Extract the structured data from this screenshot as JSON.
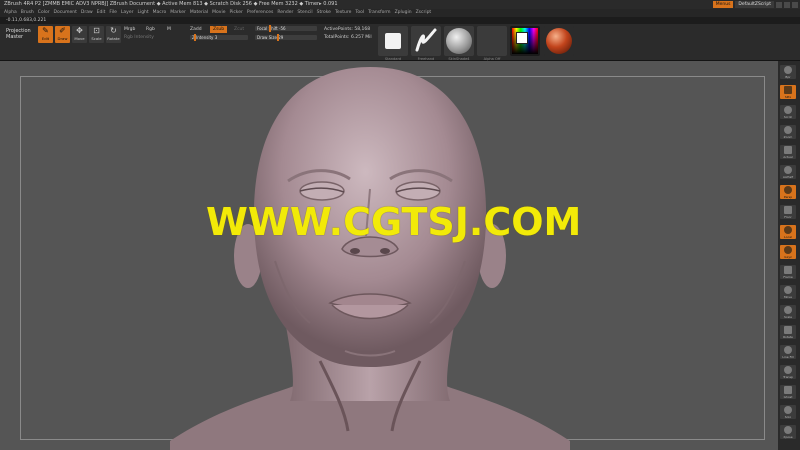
{
  "titlebar": {
    "text": "ZBrush 4R4 P2 [ZMMB EMIC ADV3 NPRBJ]   ZBrush Document      ◆ Active Mem 813  ◆ Scratch Disk 256  ◆ Free Mem 3232  ◆ Timer▸ 0.091",
    "menus_label": "Menus",
    "script_label": "DefaultZScript"
  },
  "menubar": {
    "items": [
      "Alpha",
      "Brush",
      "Color",
      "Document",
      "Draw",
      "Edit",
      "File",
      "Layer",
      "Light",
      "Macro",
      "Marker",
      "Material",
      "Movie",
      "Picker",
      "Preferences",
      "Render",
      "Stencil",
      "Stroke",
      "Texture",
      "Tool",
      "Transform",
      "Zplugin",
      "Zscript"
    ]
  },
  "coords": "-0.11,0.683,0.221",
  "toolbar": {
    "projection_line1": "Projection",
    "projection_line2": "Master",
    "buttons": [
      {
        "label": "Edit",
        "on": true
      },
      {
        "label": "Draw",
        "on": true
      },
      {
        "label": "Move",
        "on": false
      },
      {
        "label": "Scale",
        "on": false
      },
      {
        "label": "Rotate",
        "on": false
      }
    ],
    "mrgb": "Mrgb",
    "rgb": "Rgb",
    "m": "M",
    "rgb_intensity": "Rgb Intensity",
    "zadd": "Zadd",
    "zsub": "Zsub",
    "zcut": "Zcut",
    "z_intensity": "Z Intensity 3",
    "focal_shift": "Focal Shift -56",
    "draw_size": "Draw Size 29",
    "active_points": "ActivePoints: 58,168",
    "total_points": "TotalPoints: 6.257 Mil",
    "thumb_captions": [
      "Standard",
      "Freehand",
      "SkinShade4",
      "Alpha Off"
    ]
  },
  "watermark": "WWW.CGTSJ.COM",
  "rightbar": {
    "items": [
      {
        "label": "Bpr",
        "on": false
      },
      {
        "label": "SPix",
        "on": true
      },
      {
        "label": "Scroll",
        "on": false
      },
      {
        "label": "Zoom",
        "on": false
      },
      {
        "label": "Actual",
        "on": false
      },
      {
        "label": "AAHalf",
        "on": false
      },
      {
        "label": "Persp",
        "on": true
      },
      {
        "label": "Floor",
        "on": false
      },
      {
        "label": "Local",
        "on": true
      },
      {
        "label": "Gxyz",
        "on": true
      },
      {
        "label": "Frame",
        "on": false
      },
      {
        "label": "Move",
        "on": false
      },
      {
        "label": "Scale",
        "on": false
      },
      {
        "label": "Rotate",
        "on": false
      },
      {
        "label": "Line Fill",
        "on": false
      },
      {
        "label": "Transp",
        "on": false
      },
      {
        "label": "Ghost",
        "on": false
      },
      {
        "label": "Solo",
        "on": false
      },
      {
        "label": "Xpose",
        "on": false
      }
    ]
  },
  "colors": {
    "accent": "#d8731c",
    "canvas": "#555555",
    "watermark": "#f2ea08",
    "skin": "#b59ea6"
  }
}
